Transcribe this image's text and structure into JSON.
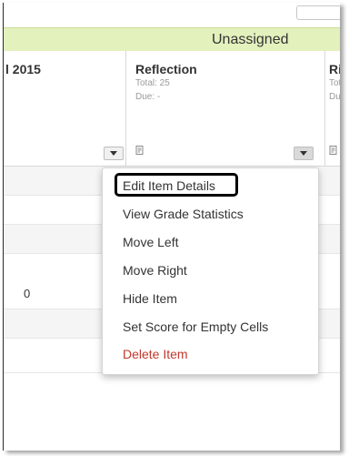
{
  "category": {
    "label": "Unassigned",
    "color": "#e3f1bd"
  },
  "columns": [
    {
      "title": "l 2015",
      "total": "",
      "due": ""
    },
    {
      "title": "Reflection",
      "total": "Total: 25",
      "due": "Due: -"
    },
    {
      "title": "Riv",
      "total": "Tota",
      "due": "Due:"
    }
  ],
  "rows": [
    {
      "value": ""
    },
    {
      "value": ""
    },
    {
      "value": ""
    },
    {
      "value": "0"
    },
    {
      "value": ""
    },
    {
      "value": ""
    }
  ],
  "menu": {
    "items": [
      {
        "label": "Edit Item Details",
        "highlighted": true
      },
      {
        "label": "View Grade Statistics"
      },
      {
        "label": "Move Left"
      },
      {
        "label": "Move Right"
      },
      {
        "label": "Hide Item"
      },
      {
        "label": "Set Score for Empty Cells"
      },
      {
        "label": "Delete Item",
        "danger": true
      }
    ],
    "danger_color": "#c0392b"
  },
  "icons": {
    "dropdown": "chevron-down-icon",
    "note": "note-icon"
  }
}
